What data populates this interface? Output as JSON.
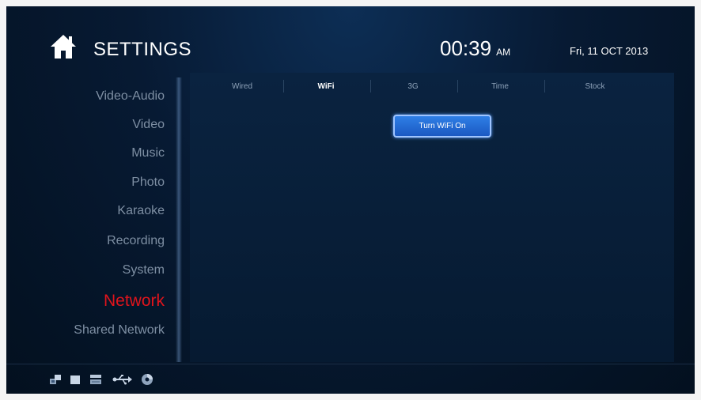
{
  "header": {
    "title": "SETTINGS",
    "time": "00:39",
    "ampm": "AM",
    "date": "Fri, 11 OCT 2013",
    "icon": "home-icon"
  },
  "sidebar": {
    "items": [
      {
        "label": "Video-Audio"
      },
      {
        "label": "Video"
      },
      {
        "label": "Music"
      },
      {
        "label": "Photo"
      },
      {
        "label": "Karaoke"
      },
      {
        "label": "Recording"
      },
      {
        "label": "System"
      },
      {
        "label": "Network",
        "active": true
      },
      {
        "label": "Shared Network"
      }
    ]
  },
  "tabs": [
    {
      "label": "Wired"
    },
    {
      "label": "WiFi",
      "active": true
    },
    {
      "label": "3G"
    },
    {
      "label": "Time"
    },
    {
      "label": "Stock"
    }
  ],
  "content": {
    "button_label": "Turn WiFi On"
  },
  "status_icons": [
    "network-icon",
    "card-icon",
    "hdd-icon",
    "usb-icon",
    "disc-icon"
  ],
  "colors": {
    "active_menu": "#e0141c",
    "button": "#1b59c2"
  }
}
